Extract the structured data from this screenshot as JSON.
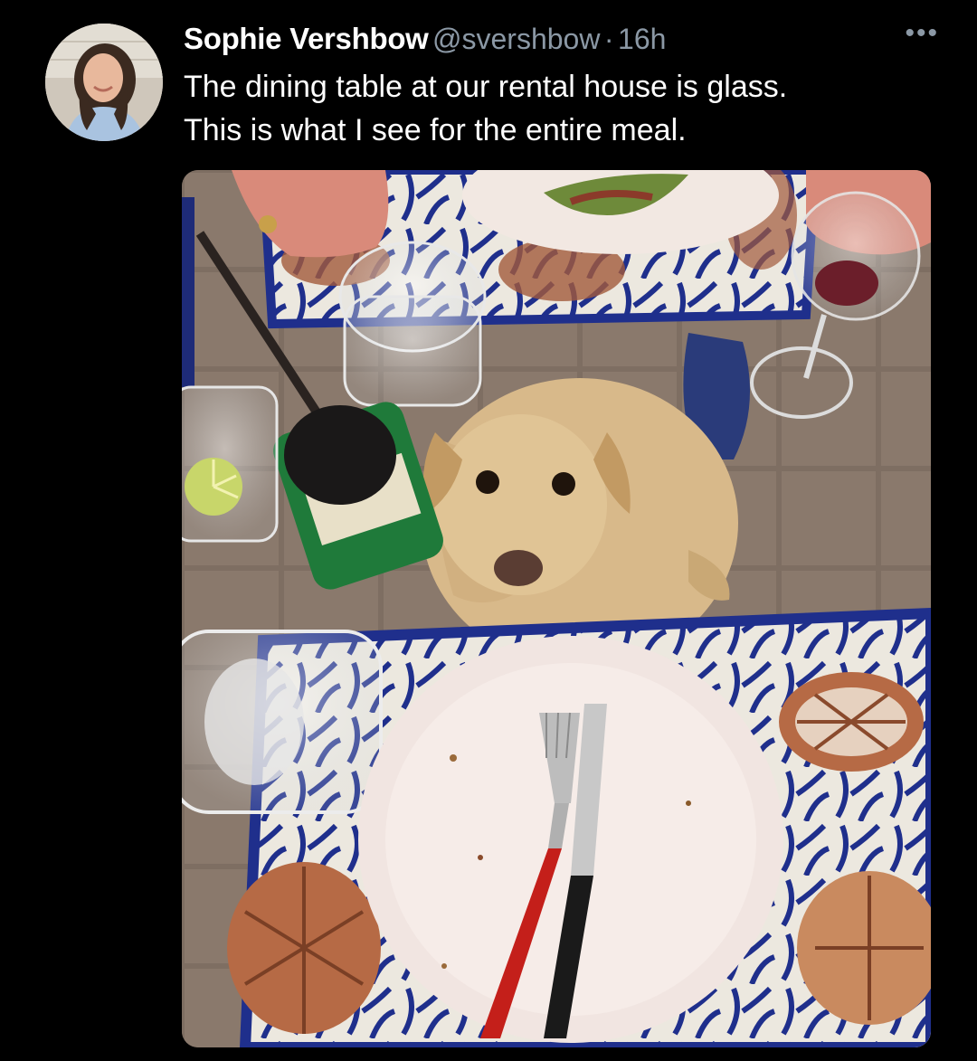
{
  "author": {
    "display_name": "Sophie Vershbow",
    "handle": "@svershbow",
    "separator": "·",
    "timestamp": "16h"
  },
  "tweet": {
    "text_line_1": "The dining table at our rental house is glass.",
    "text_line_2": "This is what I see for the entire meal."
  },
  "icons": {
    "more": "more-horizontal-icon",
    "more_glyph": "•••"
  },
  "colors": {
    "background": "#000000",
    "text_primary": "#ffffff",
    "text_secondary": "#8b98a5"
  }
}
